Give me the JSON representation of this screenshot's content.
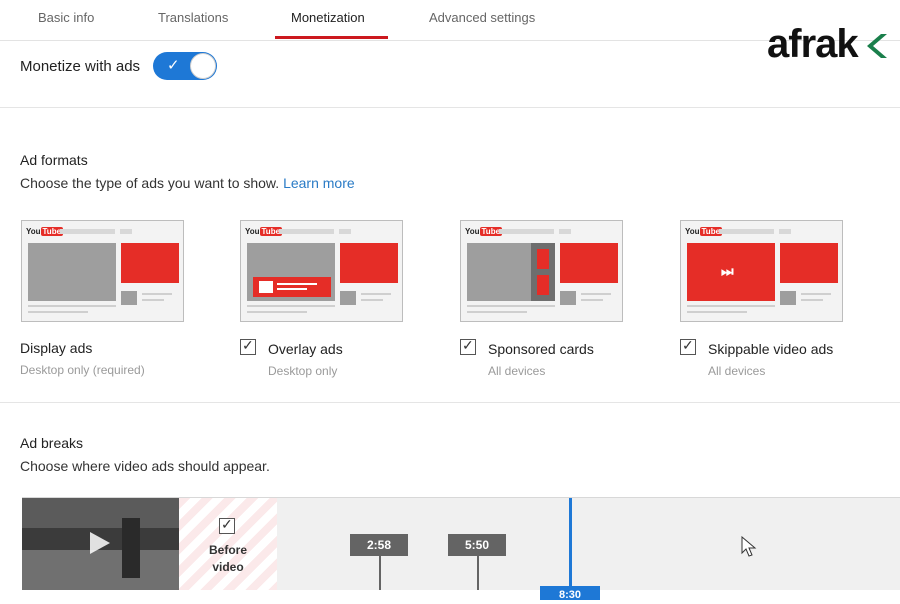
{
  "tabs": [
    {
      "label": "Basic info"
    },
    {
      "label": "Translations"
    },
    {
      "label": "Monetization"
    },
    {
      "label": "Advanced settings"
    }
  ],
  "active_tab": "Monetization",
  "logo": {
    "text": "afrak"
  },
  "monetize": {
    "label": "Monetize with ads",
    "enabled": true
  },
  "ad_formats": {
    "heading": "Ad formats",
    "description": "Choose the type of ads you want to show.",
    "learn_more": "Learn more",
    "items": [
      {
        "name": "Display ads",
        "note": "Desktop only (required)",
        "checked": null
      },
      {
        "name": "Overlay ads",
        "note": "Desktop only",
        "checked": true
      },
      {
        "name": "Sponsored cards",
        "note": "All devices",
        "checked": true
      },
      {
        "name": "Skippable video ads",
        "note": "All devices",
        "checked": true
      }
    ],
    "thumbnail_logo": "You",
    "thumbnail_logo_badge": "Tube"
  },
  "ad_breaks": {
    "heading": "Ad breaks",
    "description": "Choose where video ads should appear.",
    "before_video": {
      "label_line1": "Before",
      "label_line2": "video",
      "checked": true
    },
    "markers": [
      "2:58",
      "5:50"
    ],
    "playhead": "8:30"
  },
  "colors": {
    "accent_blue": "#1e78d6",
    "youtube_red": "#e52d27",
    "tab_red": "#cc181e"
  }
}
